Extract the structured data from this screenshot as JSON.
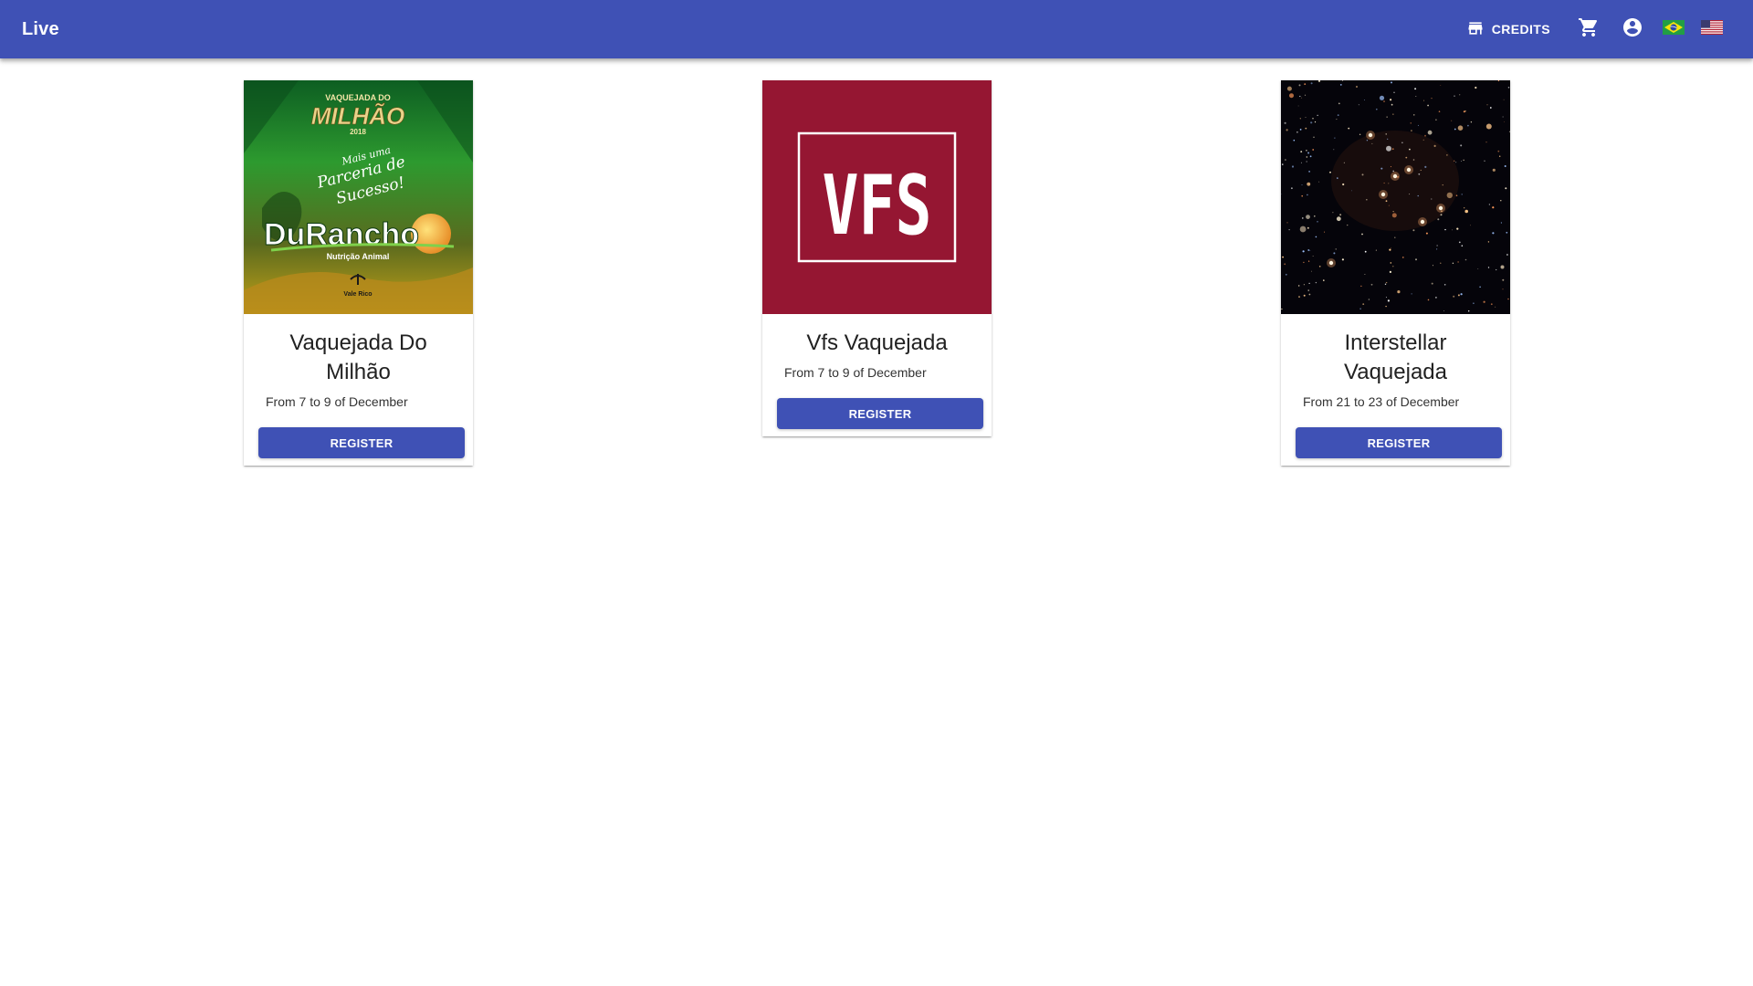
{
  "app": {
    "title": "Live"
  },
  "toolbar": {
    "credits_label": "CREDITS",
    "icons": [
      "store-icon",
      "cart-icon",
      "account-icon",
      "flag-brazil-icon",
      "flag-usa-icon"
    ]
  },
  "colors": {
    "primary": "#3f51b5",
    "card2_media_bg": "#951632",
    "star_field_bg": "#05040a"
  },
  "events": [
    {
      "title": "Vaquejada Do Milhão",
      "date": "From 7 to 9 of December",
      "button": "REGISTER",
      "poster": {
        "header": "VAQUEJADA DO",
        "big": "MILHÃO",
        "year": "2018",
        "script1": "Mais uma",
        "script2": "Parceria de",
        "script3": "Sucesso!",
        "brand": "DuRancho",
        "tagline": "Nutrição Animal",
        "sponsor": "Vale Rico"
      }
    },
    {
      "title": "Vfs Vaquejada",
      "date": "From 7 to 9 of December",
      "button": "REGISTER",
      "logo": "VFS"
    },
    {
      "title": "Interstellar Vaquejada",
      "date": "From 21 to 23 of December",
      "button": "REGISTER"
    }
  ]
}
